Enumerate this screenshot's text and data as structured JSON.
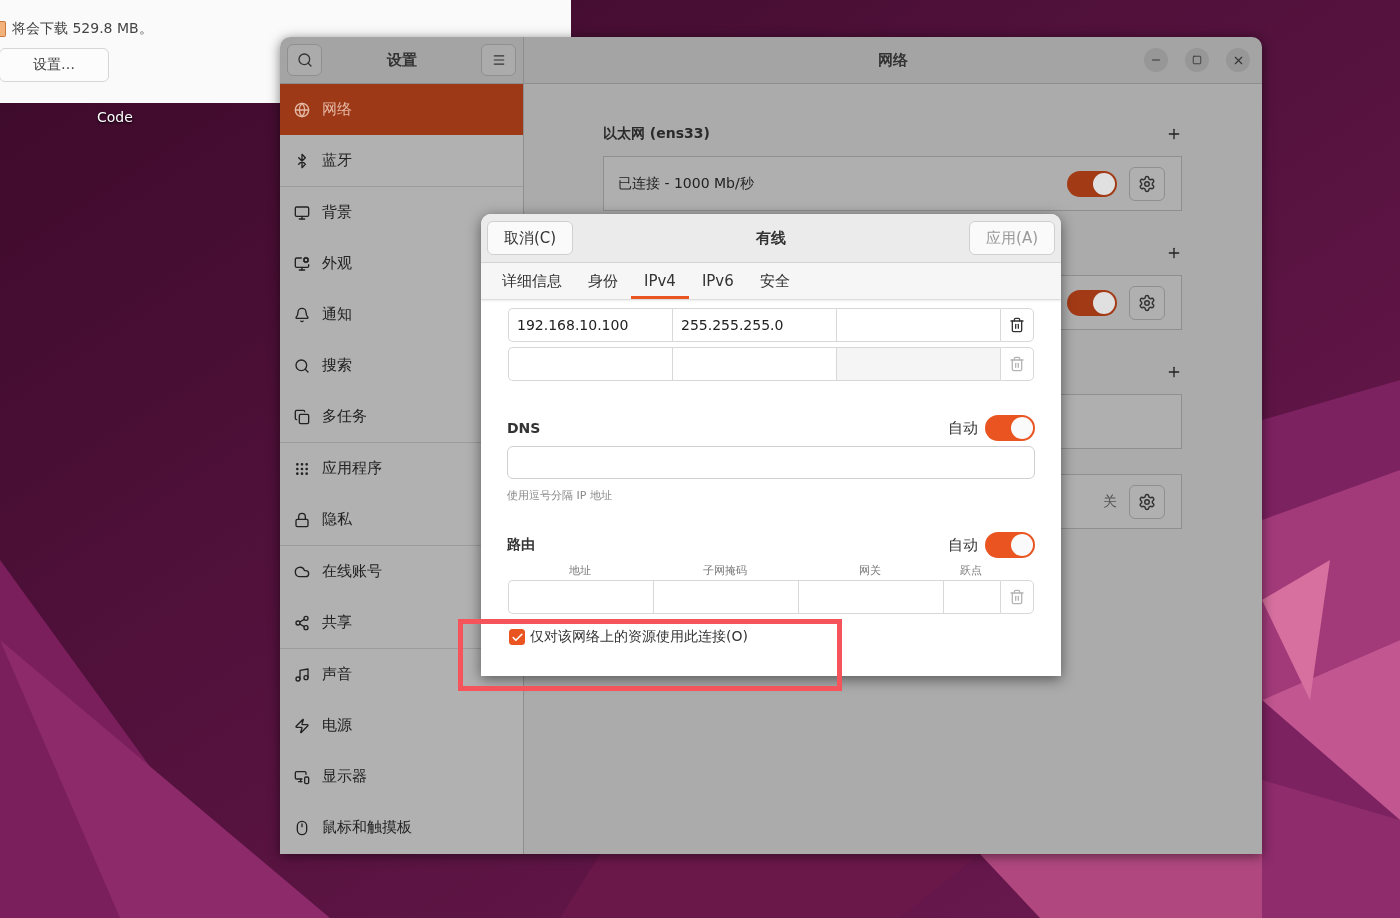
{
  "desktop": {
    "icon_label": "Code"
  },
  "updater": {
    "note": "将会下载 529.8 MB。",
    "settings_button": "设置…"
  },
  "settings": {
    "title": "设置",
    "sidebar_groups": [
      [
        {
          "label": "网络",
          "selected": true
        },
        {
          "label": "蓝牙",
          "selected": false
        }
      ],
      [
        {
          "label": "背景",
          "selected": false
        },
        {
          "label": "外观",
          "selected": false
        },
        {
          "label": "通知",
          "selected": false
        },
        {
          "label": "搜索",
          "selected": false
        },
        {
          "label": "多任务",
          "selected": false
        }
      ],
      [
        {
          "label": "应用程序",
          "selected": false
        },
        {
          "label": "隐私",
          "selected": false
        }
      ],
      [
        {
          "label": "在线账号",
          "selected": false
        },
        {
          "label": "共享",
          "selected": false
        }
      ],
      [
        {
          "label": "声音",
          "selected": false
        },
        {
          "label": "电源",
          "selected": false
        },
        {
          "label": "显示器",
          "selected": false
        },
        {
          "label": "鼠标和触摸板",
          "selected": false
        }
      ]
    ],
    "panel_title": "网络",
    "sections": [
      {
        "title": "以太网 (ens33)",
        "cards": [
          {
            "kind": "toggle",
            "status": "已连接 - 1000 Mb/秒",
            "on": true
          }
        ]
      },
      {
        "cards": [
          {
            "kind": "toggle",
            "on": true
          }
        ]
      },
      {
        "cards": [
          {
            "kind": "blank"
          },
          {
            "kind": "state",
            "state": "关"
          }
        ]
      }
    ]
  },
  "dialog": {
    "title": "有线",
    "cancel": "取消(C)",
    "apply": {
      "label": "应用(A)",
      "disabled": true
    },
    "tabs": [
      {
        "label": "详细信息",
        "selected": false
      },
      {
        "label": "身份",
        "selected": false
      },
      {
        "label": "IPv4",
        "selected": true
      },
      {
        "label": "IPv6",
        "selected": false
      },
      {
        "label": "安全",
        "selected": false
      }
    ],
    "addresses": [
      {
        "address": "192.168.10.100",
        "netmask": "255.255.255.0",
        "removable": true
      },
      {
        "removable": false
      }
    ],
    "dns": {
      "label": "DNS",
      "auto_label": "自动",
      "auto": true,
      "hint": "使用逗号分隔 IP 地址"
    },
    "routes": {
      "label": "路由",
      "auto_label": "自动",
      "auto": true,
      "columns": [
        "地址",
        "子网掩码",
        "网关",
        "跃点"
      ],
      "rows": [
        {
          "removable": false
        }
      ]
    },
    "only_local": {
      "label": "仅对该网络上的资源使用此连接(O)",
      "checked": true
    }
  },
  "annotation": {
    "kind": "highlight-box"
  }
}
